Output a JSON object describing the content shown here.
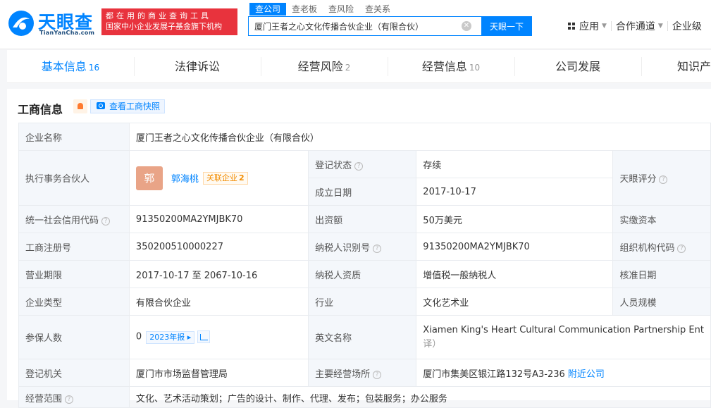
{
  "header": {
    "logo_cn": "天眼查",
    "logo_en": "TianYanCha.com",
    "slogan_line1": "都在用的商业查询工具",
    "slogan_line2": "国家中小企业发展子基金旗下机构",
    "search_tabs": [
      "查公司",
      "查老板",
      "查风险",
      "查关系"
    ],
    "search_value": "厦门王者之心文化传播合伙企业（有限合伙）",
    "search_button": "天眼一下",
    "nav": [
      "应用",
      "合作通道",
      "企业级"
    ]
  },
  "tabs": [
    {
      "label": "基本信息",
      "count": "16"
    },
    {
      "label": "法律诉讼",
      "count": ""
    },
    {
      "label": "经营风险",
      "count": "2"
    },
    {
      "label": "经营信息",
      "count": "10"
    },
    {
      "label": "公司发展",
      "count": ""
    },
    {
      "label": "知识产",
      "count": ""
    }
  ],
  "section": {
    "title": "工商信息",
    "snapshot_label": "查看工商快照"
  },
  "info": {
    "company_name_label": "企业名称",
    "company_name": "厦门王者之心文化传播合伙企业（有限合伙）",
    "partner_label": "执行事务合伙人",
    "partner_avatar": "郭",
    "partner_name": "郭海桃",
    "related_label": "关联企业",
    "related_count": "2",
    "status_label": "登记状态",
    "status": "存续",
    "founded_label": "成立日期",
    "founded": "2017-10-17",
    "score_label": "天眼评分",
    "credit_code_label": "统一社会信用代码",
    "credit_code": "91350200MA2YMJBK70",
    "capital_label": "出资额",
    "capital": "50万美元",
    "paid_capital_label": "实缴资本",
    "reg_no_label": "工商注册号",
    "reg_no": "350200510000227",
    "taxpayer_id_label": "纳税人识别号",
    "taxpayer_id": "91350200MA2YMJBK70",
    "org_code_label": "组织机构代码",
    "term_label": "营业期限",
    "term": "2017-10-17 至 2067-10-16",
    "taxpayer_type_label": "纳税人资质",
    "taxpayer_type": "增值税一般纳税人",
    "approve_date_label": "核准日期",
    "type_label": "企业类型",
    "type": "有限合伙企业",
    "industry_label": "行业",
    "industry": "文化艺术业",
    "staff_size_label": "人员规模",
    "insured_label": "参保人数",
    "insured": "0",
    "insured_report": "2023年报",
    "english_name_label": "英文名称",
    "english_name": "Xiamen King's Heart Cultural Communication Partnership Ent",
    "english_name_note": "译）",
    "authority_label": "登记机关",
    "authority": "厦门市市场监督管理局",
    "address_label": "主要经营场所",
    "address": "厦门市集美区银江路132号A3-236",
    "nearby_label": "附近公司",
    "scope_label": "经营范围",
    "scope": "文化、艺术活动策划；广告的设计、制作、代理、发布；包装服务；办公服务"
  }
}
